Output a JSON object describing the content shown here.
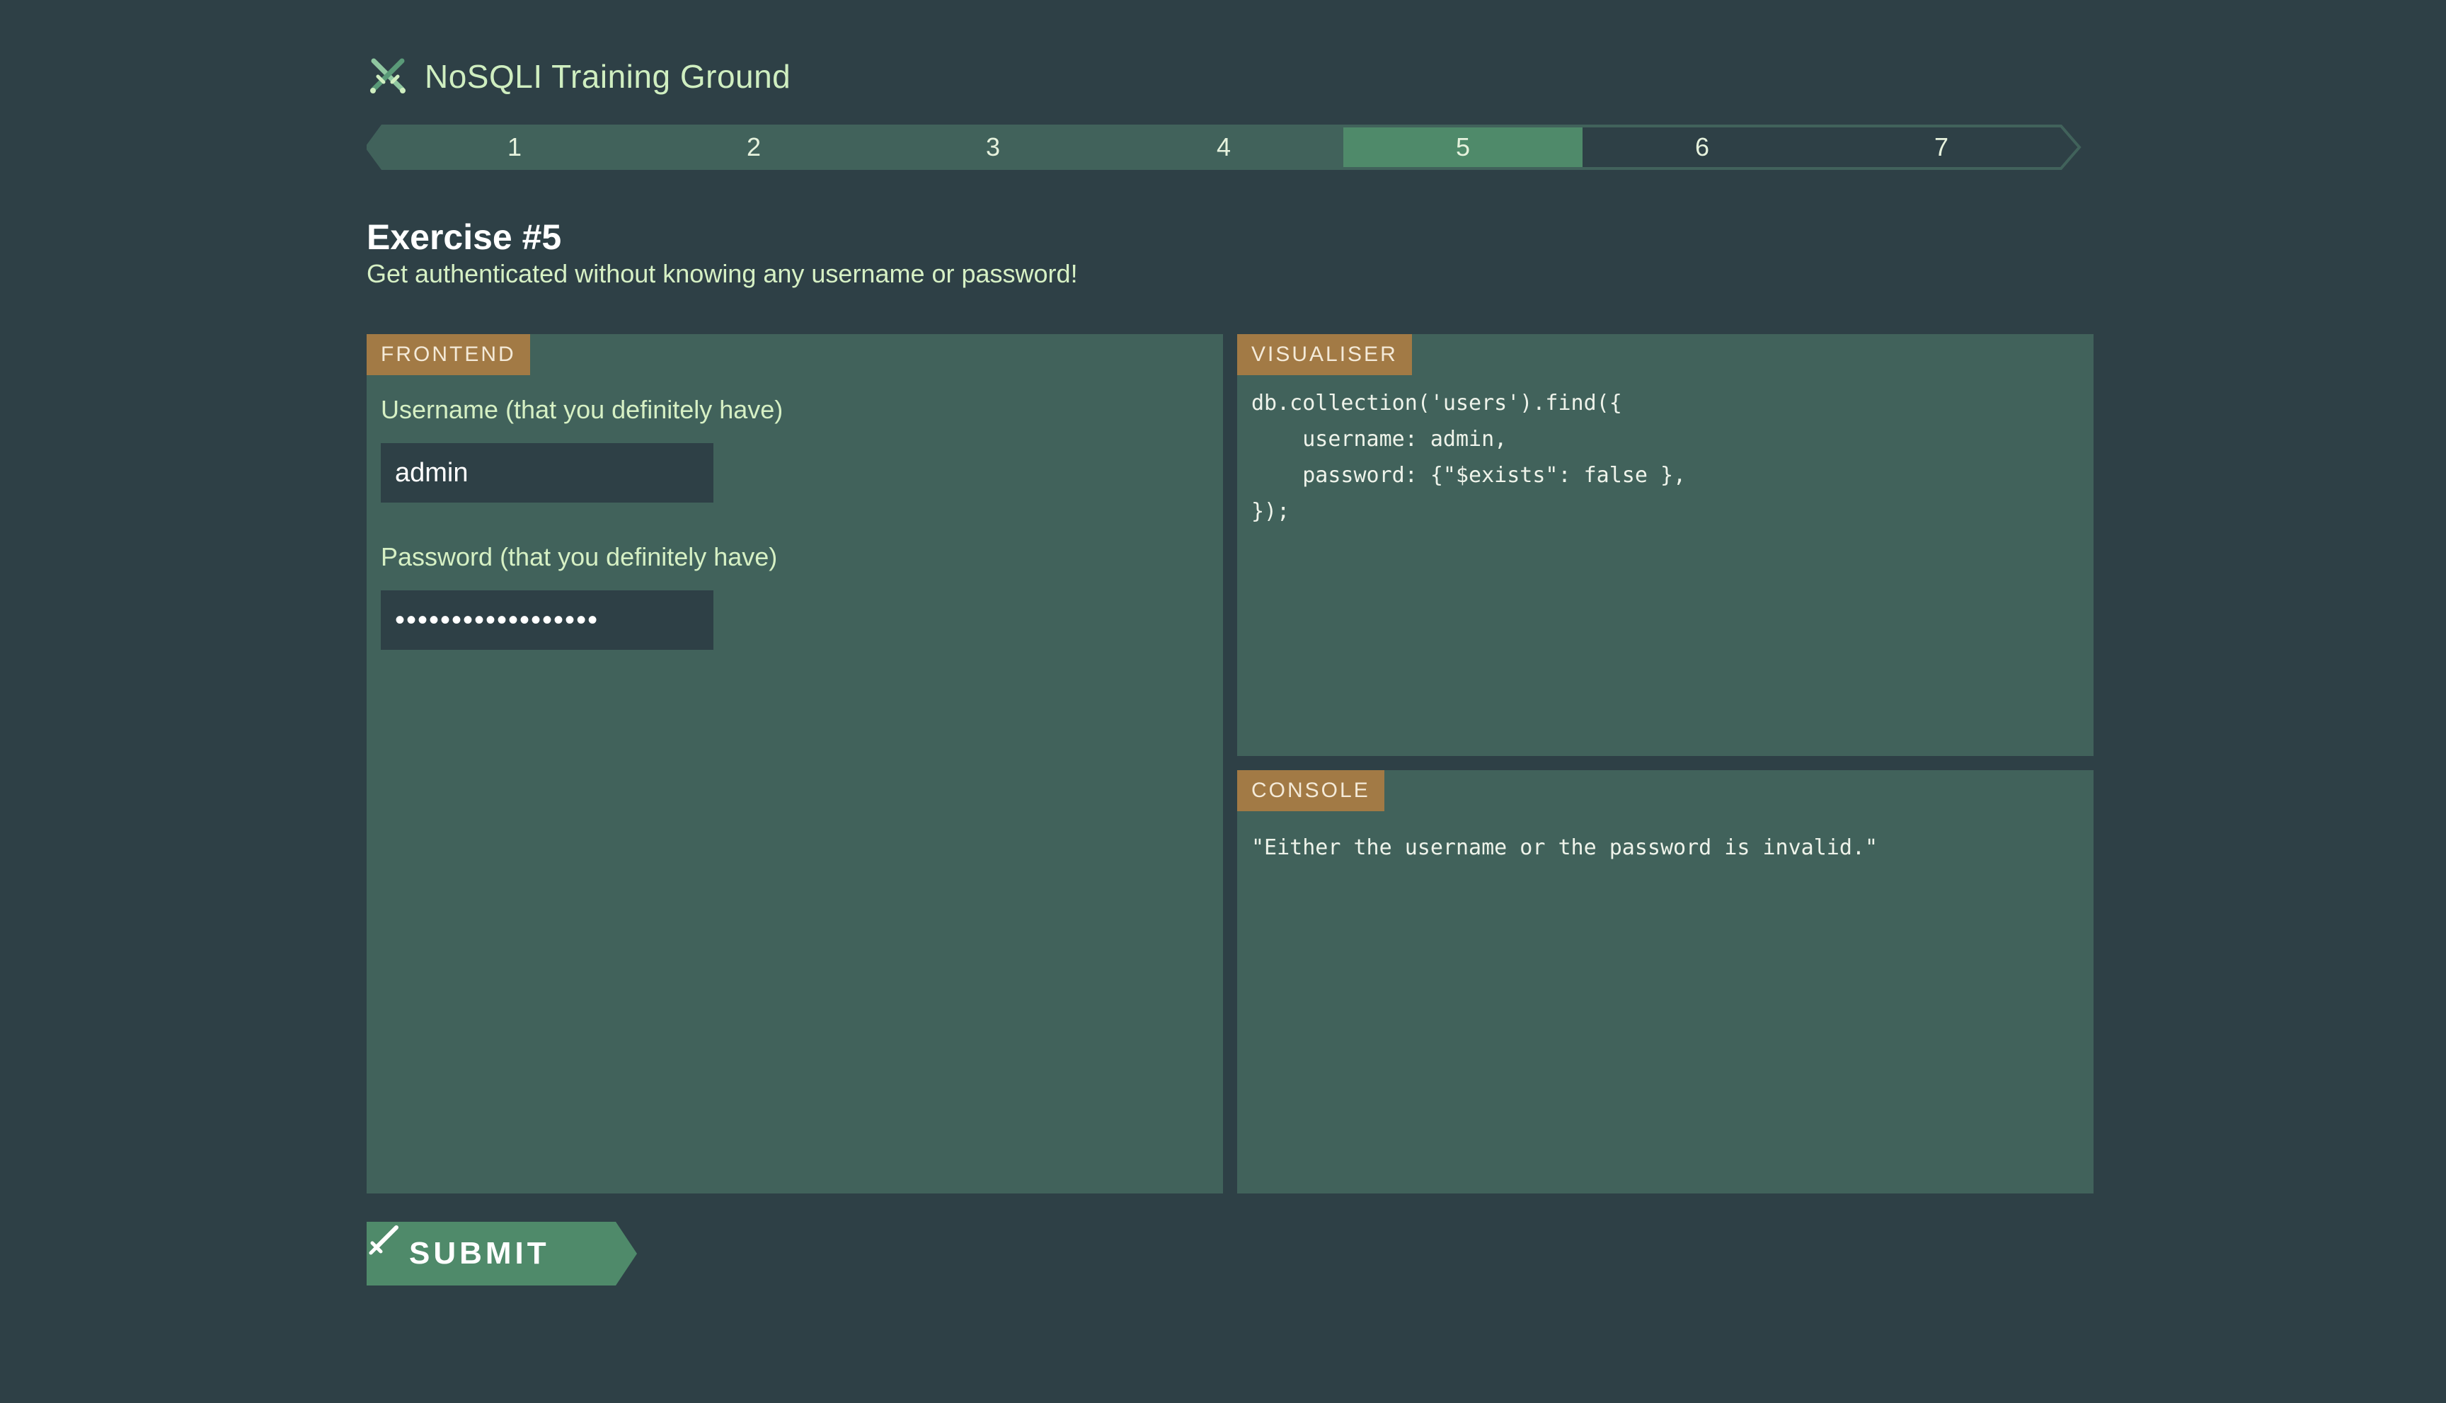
{
  "app": {
    "title": "NoSQLI Training Ground",
    "logo_icon": "crossed-swords-icon"
  },
  "steps": {
    "items": [
      "1",
      "2",
      "3",
      "4",
      "5",
      "6",
      "7"
    ],
    "active": "5",
    "completed": [
      "1",
      "2",
      "3",
      "4"
    ]
  },
  "exercise": {
    "title": "Exercise #5",
    "description": "Get authenticated without knowing any username or password!"
  },
  "frontend": {
    "tag": "FRONTEND",
    "username_label": "Username (that you definitely have)",
    "username_value": "admin",
    "password_label": "Password (that you definitely have)",
    "password_value": "••••••••••••••••••"
  },
  "visualiser": {
    "tag": "VISUALISER",
    "code": "db.collection('users').find({\n    username: admin,\n    password: {\"$exists\": false },\n});"
  },
  "console": {
    "tag": "CONSOLE",
    "output": "\"Either the username or the password is invalid.\""
  },
  "submit": {
    "label": "SUBMIT",
    "icon": "sword-icon"
  },
  "colors": {
    "background": "#2e4046",
    "panel": "#41625b",
    "accent": "#4f8a6a",
    "tag": "#a27a45",
    "text_light": "#d6f0c4"
  }
}
